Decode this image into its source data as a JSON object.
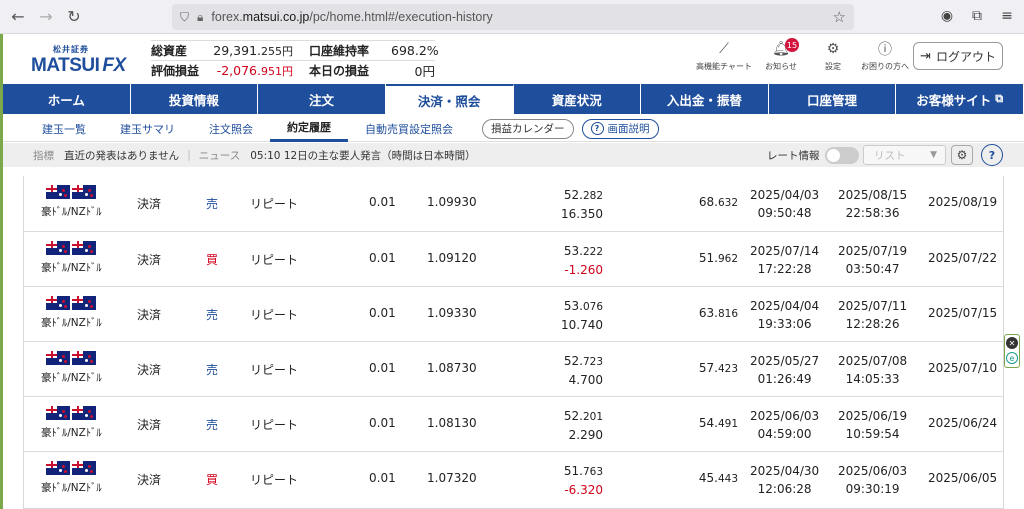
{
  "browser": {
    "url_prefix": "forex.",
    "url_domain": "matsui.co.jp",
    "url_path": "/pc/home.html#/execution-history"
  },
  "header": {
    "logo_small": "松井証券",
    "logo_main": "MATSUI",
    "logo_fx": "FX",
    "total_assets_label": "総資産",
    "total_assets_value": "29,391.",
    "total_assets_decimal": "255円",
    "unrealized_label": "評価損益",
    "unrealized_value": "-2,076.",
    "unrealized_decimal": "951円",
    "margin_ratio_label": "口座維持率",
    "margin_ratio_value": "698.2%",
    "today_pl_label": "本日の損益",
    "today_pl_value": "0円",
    "tools": [
      {
        "label": "高機能チャート"
      },
      {
        "label": "お知らせ",
        "badge": "15"
      },
      {
        "label": "設定"
      },
      {
        "label": "お困りの方へ"
      }
    ],
    "logout_label": "ログアウト"
  },
  "mainnav": [
    "ホーム",
    "投資情報",
    "注文",
    "決済・照会",
    "資産状況",
    "入出金・振替",
    "口座管理",
    "お客様サイト"
  ],
  "subnav": [
    "建玉一覧",
    "建玉サマリ",
    "注文照会",
    "約定履歴",
    "自動売買設定照会"
  ],
  "subnav_pill": "損益カレンダー",
  "subnav_help": "画面説明",
  "ticker": {
    "indicator_label": "指標",
    "indicator_value": "直近の発表はありません",
    "news_label": "ニュース",
    "news_value": "05:10 12日の主な要人発言（時間は日本時間）",
    "rate_label": "レート情報",
    "list_placeholder": "リスト"
  },
  "rows": [
    {
      "pair": "豪ﾄﾞﾙ/NZﾄﾞﾙ",
      "type": "決済",
      "side": "売",
      "order": "リピート",
      "qty": "0.01",
      "price": "1.09930",
      "pl_main": "52.",
      "pl_dec": "282",
      "pl_sub": "16.350",
      "swap_main": "68.",
      "swap_dec": "632",
      "d1a": "2025/04/03",
      "d1b": "09:50:48",
      "d2a": "2025/08/15",
      "d2b": "22:58:36",
      "d3": "2025/08/19"
    },
    {
      "pair": "豪ﾄﾞﾙ/NZﾄﾞﾙ",
      "type": "決済",
      "side": "買",
      "order": "リピート",
      "qty": "0.01",
      "price": "1.09120",
      "pl_main": "53.",
      "pl_dec": "222",
      "pl_sub": "-1.260",
      "swap_main": "51.",
      "swap_dec": "962",
      "d1a": "2025/07/14",
      "d1b": "17:22:28",
      "d2a": "2025/07/19",
      "d2b": "03:50:47",
      "d3": "2025/07/22"
    },
    {
      "pair": "豪ﾄﾞﾙ/NZﾄﾞﾙ",
      "type": "決済",
      "side": "売",
      "order": "リピート",
      "qty": "0.01",
      "price": "1.09330",
      "pl_main": "53.",
      "pl_dec": "076",
      "pl_sub": "10.740",
      "swap_main": "63.",
      "swap_dec": "816",
      "d1a": "2025/04/04",
      "d1b": "19:33:06",
      "d2a": "2025/07/11",
      "d2b": "12:28:26",
      "d3": "2025/07/15"
    },
    {
      "pair": "豪ﾄﾞﾙ/NZﾄﾞﾙ",
      "type": "決済",
      "side": "売",
      "order": "リピート",
      "qty": "0.01",
      "price": "1.08730",
      "pl_main": "52.",
      "pl_dec": "723",
      "pl_sub": "4.700",
      "swap_main": "57.",
      "swap_dec": "423",
      "d1a": "2025/05/27",
      "d1b": "01:26:49",
      "d2a": "2025/07/08",
      "d2b": "14:05:33",
      "d3": "2025/07/10"
    },
    {
      "pair": "豪ﾄﾞﾙ/NZﾄﾞﾙ",
      "type": "決済",
      "side": "売",
      "order": "リピート",
      "qty": "0.01",
      "price": "1.08130",
      "pl_main": "52.",
      "pl_dec": "201",
      "pl_sub": "2.290",
      "swap_main": "54.",
      "swap_dec": "491",
      "d1a": "2025/06/03",
      "d1b": "04:59:00",
      "d2a": "2025/06/19",
      "d2b": "10:59:54",
      "d3": "2025/06/24"
    },
    {
      "pair": "豪ﾄﾞﾙ/NZﾄﾞﾙ",
      "type": "決済",
      "side": "買",
      "order": "リピート",
      "qty": "0.01",
      "price": "1.07320",
      "pl_main": "51.",
      "pl_dec": "763",
      "pl_sub": "-6.320",
      "swap_main": "45.",
      "swap_dec": "443",
      "d1a": "2025/04/30",
      "d1b": "12:06:28",
      "d2a": "2025/06/03",
      "d2b": "09:30:19",
      "d3": "2025/06/05"
    }
  ],
  "colors": {
    "brand": "#1f4e9c",
    "negative": "#d0021b",
    "sell": "#1f4e9c",
    "buy": "#d0021b"
  }
}
